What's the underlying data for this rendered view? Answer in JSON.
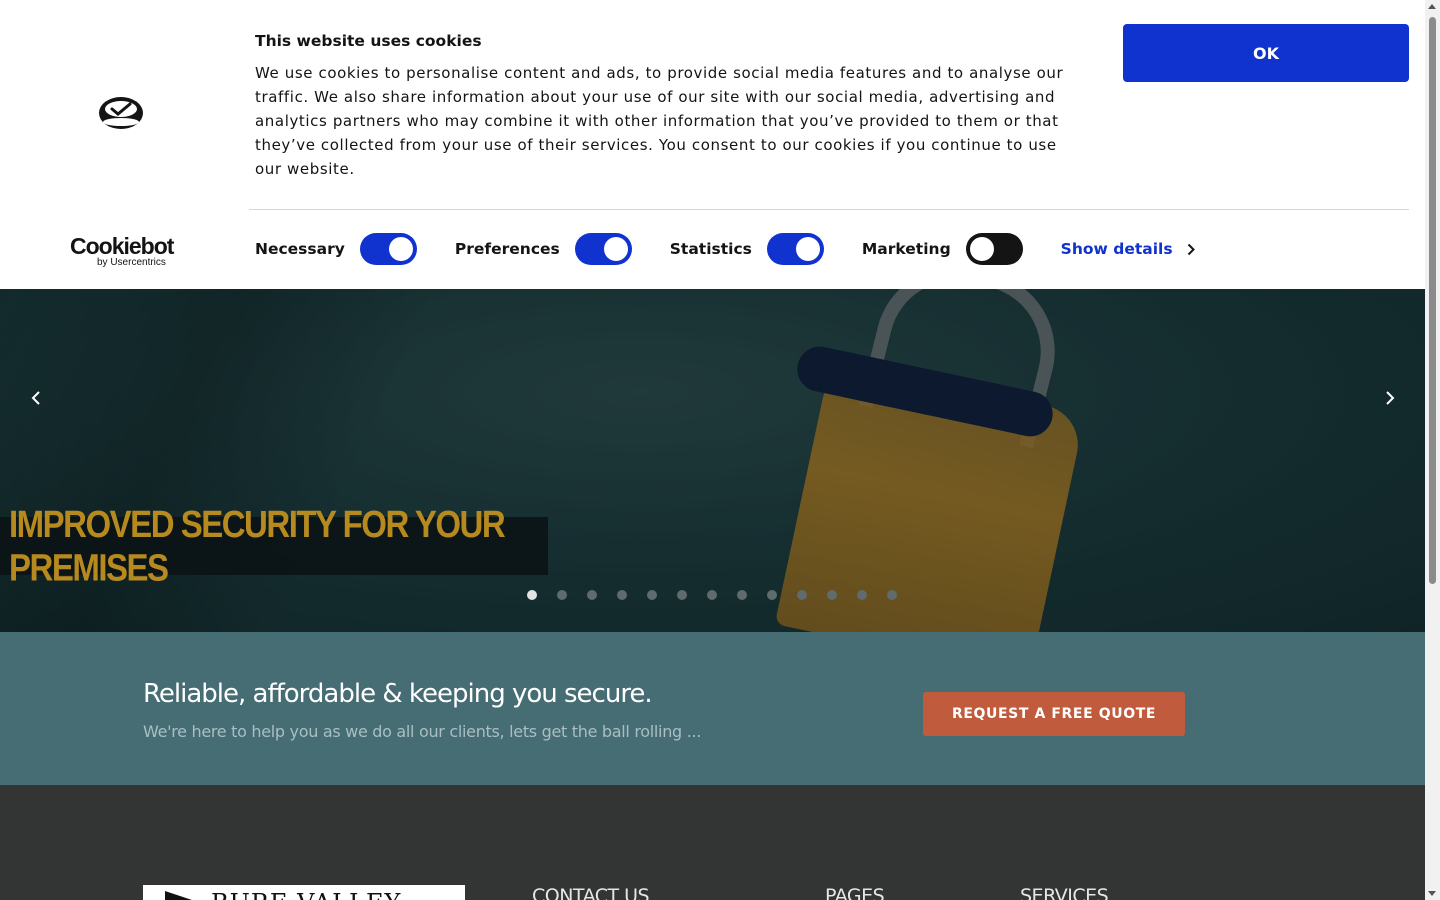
{
  "cookie_banner": {
    "logo_icon": "cookiebot-cup-icon",
    "brand_name": "Cookiebot",
    "brand_sub": "by Usercentrics",
    "title": "This website uses cookies",
    "text": "We use cookies to personalise content and ads, to provide social media features and to analyse our traffic. We also share information about your use of our site with our social media, advertising and analytics partners who may combine it with other information that you’ve provided to them or that they’ve collected from your use of their services. You consent to our cookies if you continue to use our website.",
    "ok_label": "OK",
    "toggles": [
      {
        "label": "Necessary",
        "state": "on"
      },
      {
        "label": "Preferences",
        "state": "on"
      },
      {
        "label": "Statistics",
        "state": "on"
      },
      {
        "label": "Marketing",
        "state": "off"
      }
    ],
    "show_details_label": "Show details",
    "colors": {
      "accent": "#1032cf",
      "text": "#141414"
    }
  },
  "hero": {
    "caption": "IMPROVED SECURITY FOR YOUR PREMISES",
    "prev_icon": "chevron-left-icon",
    "next_icon": "chevron-right-icon",
    "slide_count": 13,
    "active_slide": 1
  },
  "cta": {
    "title": "Reliable, affordable & keeping you secure.",
    "subtitle": "We're here to help you as we do all our clients, lets get the ball rolling ...",
    "button_label": "REQUEST A FREE QUOTE",
    "colors": {
      "band": "#466c74",
      "button": "#c15b3e"
    }
  },
  "footer": {
    "logo_text": "BURE VALLEY",
    "headings": [
      "CONTACT US",
      "PAGES",
      "SERVICES"
    ]
  }
}
